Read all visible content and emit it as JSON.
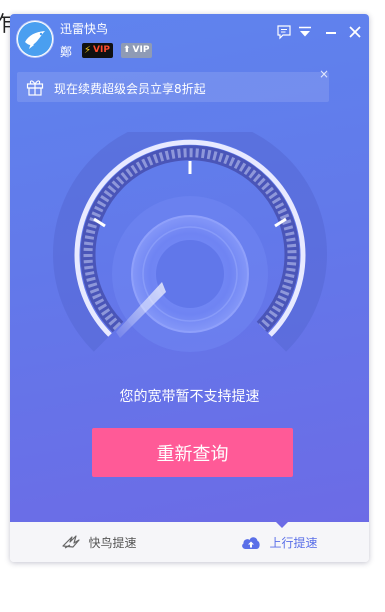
{
  "background_fragment": "咋",
  "header": {
    "app_title": "迅雷快鸟",
    "user_name": "鄭",
    "vip_badges": [
      "VIP",
      "VIP"
    ],
    "icons": [
      "message-icon",
      "dropdown-menu-icon",
      "minimize-icon",
      "close-icon"
    ]
  },
  "promo": {
    "text": "现在续费超级会员立享8折起",
    "close_label": "×"
  },
  "speed_gauge": {
    "needle_level": 0.0
  },
  "status": {
    "message": "您的宽带暂不支持提速"
  },
  "actions": {
    "recheck_label": "重新查询"
  },
  "tabs": [
    {
      "label": "快鸟提速",
      "icon": "bird-icon",
      "active": false
    },
    {
      "label": "上行提速",
      "icon": "cloud-upload-icon",
      "active": true
    }
  ],
  "colors": {
    "accent": "#5a6fe8",
    "button": "#ff5a97",
    "panel_top": "#5f84ee",
    "panel_bottom": "#6c6be6"
  }
}
